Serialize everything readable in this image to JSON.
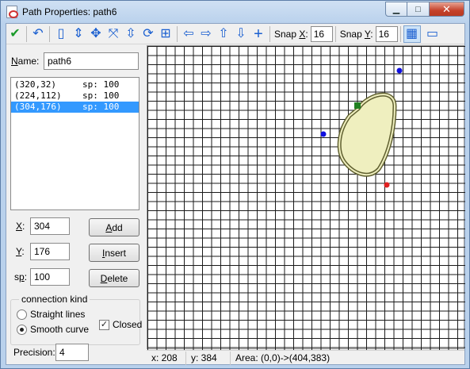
{
  "window": {
    "title": "Path Properties: path6",
    "minimize_glyph": "▁",
    "maximize_glyph": "□",
    "close_glyph": "✕"
  },
  "toolbar": {
    "ok_glyph": "✔",
    "undo_glyph": "↶",
    "new_glyph": "▯",
    "flip_v_glyph": "⇕",
    "move_glyph": "✥",
    "scale_glyph": "⤧",
    "flip_glyph": "⇳",
    "rotate_glyph": "⟳",
    "merge_glyph": "⊞",
    "left_glyph": "⇦",
    "right_glyph": "⇨",
    "up_glyph": "⇧",
    "down_glyph": "⇩",
    "center_glyph": "+",
    "snap_x_label_prefix": "Snap ",
    "snap_x_label_key": "X",
    "snap_x_label_suffix": ":",
    "snap_x_value": "16",
    "snap_y_label_prefix": "Snap ",
    "snap_y_label_key": "Y",
    "snap_y_label_suffix": ":",
    "snap_y_value": "16",
    "grid_glyph": "▦",
    "room_glyph": "▭"
  },
  "form": {
    "name_label_key": "N",
    "name_label_rest": "ame:",
    "name_value": "path6",
    "points": [
      {
        "coord": "(320,32)",
        "sp": "sp: 100",
        "selected": false
      },
      {
        "coord": "(224,112)",
        "sp": "sp: 100",
        "selected": false
      },
      {
        "coord": "(304,176)",
        "sp": "sp: 100",
        "selected": true
      }
    ],
    "x_label_key": "X",
    "x_label_suffix": ":",
    "x_value": "304",
    "y_label_key": "Y",
    "y_label_suffix": ":",
    "y_value": "176",
    "sp_label_prefix": "s",
    "sp_label_key": "p",
    "sp_label_suffix": ":",
    "sp_value": "100",
    "add_label_key": "A",
    "add_label_rest": "dd",
    "insert_label_key": "I",
    "insert_label_rest": "nsert",
    "delete_label_key": "D",
    "delete_label_rest": "elete",
    "connection_kind_label": "connection kind",
    "straight_label": "Straight lines",
    "smooth_label": "Smooth curve",
    "closed_label": "Closed",
    "closed_checked": "✓",
    "precision_label": "Precision:",
    "precision_value": "4"
  },
  "status": {
    "x": "x: 208",
    "y": "y: 384",
    "area": "Area: (0,0)->(404,383)"
  },
  "colors": {
    "selected_row": "#3399ff",
    "path_fill": "#efefbf",
    "path_stroke": "#606030",
    "point_blue": "#1010e0",
    "point_red": "#e02020",
    "point_green": "#208020"
  }
}
